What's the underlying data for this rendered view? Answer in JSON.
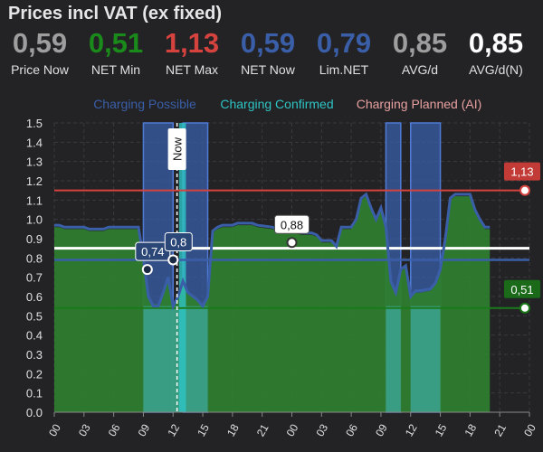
{
  "card": {
    "title": "Prices incl VAT (ex fixed)"
  },
  "stats": [
    {
      "value": "0,59",
      "label": "Price Now",
      "color": "#9e9e9e"
    },
    {
      "value": "0,51",
      "label": "NET Min",
      "color": "#1a8a1a"
    },
    {
      "value": "1,13",
      "label": "NET Max",
      "color": "#d6433f"
    },
    {
      "value": "0,59",
      "label": "NET Now",
      "color": "#3a5fa8"
    },
    {
      "value": "0,79",
      "label": "Lim.NET",
      "color": "#3a5fa8"
    },
    {
      "value": "0,85",
      "label": "AVG/d",
      "color": "#9e9e9e"
    },
    {
      "value": "0,85",
      "label": "AVG/d(N)",
      "color": "#ffffff"
    }
  ],
  "chart_data": {
    "type": "area",
    "title": "",
    "xlabel": "",
    "ylabel": "",
    "x_ticks": [
      "00",
      "03",
      "06",
      "09",
      "12",
      "15",
      "18",
      "21",
      "00",
      "03",
      "06",
      "09",
      "12",
      "15",
      "18",
      "21",
      "00"
    ],
    "y_ticks": [
      "0.0",
      "0.1",
      "0.2",
      "0.3",
      "0.4",
      "0.5",
      "0.6",
      "0.7",
      "0.8",
      "0.9",
      "1.0",
      "1.1",
      "1.2",
      "1.3",
      "1.4",
      "1.5"
    ],
    "ylim": [
      0,
      1.5
    ],
    "xlim": [
      0,
      48
    ],
    "grid": true,
    "legend": [
      "Charging Possible",
      "Charging Confirmed",
      "Charging Planned (AI)"
    ],
    "legend_position": "top",
    "colors": {
      "net_price": "#2e7d2e",
      "price_line": "#3a5fa8",
      "charging_possible": "#3a5fa8",
      "charging_confirmed": "#2ec4c4",
      "charging_planned": "#e8a0a0",
      "max_line": "#d6433f",
      "min_line": "#1a7a1a",
      "avg_line": "#ffffff",
      "lim_line": "#3a5fa8"
    },
    "net_price": [
      [
        0,
        0.96
      ],
      [
        0.5,
        0.96
      ],
      [
        1,
        0.95
      ],
      [
        3,
        0.95
      ],
      [
        3.5,
        0.94
      ],
      [
        5,
        0.94
      ],
      [
        5.5,
        0.95
      ],
      [
        7,
        0.95
      ],
      [
        7.5,
        0.95
      ],
      [
        8.5,
        0.95
      ],
      [
        9,
        0.8
      ],
      [
        9.5,
        0.6
      ],
      [
        10,
        0.56
      ],
      [
        10.5,
        0.56
      ],
      [
        11,
        0.62
      ],
      [
        11.5,
        0.7
      ],
      [
        12,
        0.55
      ],
      [
        12.5,
        0.6
      ],
      [
        13,
        0.68
      ],
      [
        13.5,
        0.62
      ],
      [
        14,
        0.6
      ],
      [
        14.5,
        0.58
      ],
      [
        15,
        0.56
      ],
      [
        15.5,
        0.6
      ],
      [
        16,
        0.93
      ],
      [
        16.5,
        0.95
      ],
      [
        17,
        0.96
      ],
      [
        18,
        0.96
      ],
      [
        18.5,
        0.97
      ],
      [
        20,
        0.97
      ],
      [
        20.5,
        0.96
      ],
      [
        22,
        0.95
      ],
      [
        22.5,
        0.94
      ],
      [
        24,
        0.93
      ],
      [
        25,
        0.92
      ],
      [
        26,
        0.92
      ],
      [
        26.5,
        0.91
      ],
      [
        27,
        0.88
      ],
      [
        28,
        0.88
      ],
      [
        28.5,
        0.85
      ],
      [
        29,
        0.95
      ],
      [
        30,
        0.95
      ],
      [
        30.5,
        1.0
      ],
      [
        31,
        1.1
      ],
      [
        31.5,
        1.12
      ],
      [
        32,
        1.05
      ],
      [
        32.5,
        1.0
      ],
      [
        33,
        1.05
      ],
      [
        33.5,
        0.95
      ],
      [
        34,
        0.68
      ],
      [
        34.5,
        0.62
      ],
      [
        35,
        0.73
      ],
      [
        35.5,
        0.75
      ],
      [
        36,
        0.6
      ],
      [
        36.5,
        0.62
      ],
      [
        37,
        0.62
      ],
      [
        38,
        0.63
      ],
      [
        38.5,
        0.66
      ],
      [
        39,
        0.73
      ],
      [
        39.5,
        0.9
      ],
      [
        40,
        1.1
      ],
      [
        40.5,
        1.12
      ],
      [
        41,
        1.12
      ],
      [
        42,
        1.12
      ],
      [
        42.5,
        1.04
      ],
      [
        43,
        1.0
      ],
      [
        43.5,
        0.95
      ],
      [
        44,
        0.95
      ]
    ],
    "price_line": [
      [
        0,
        0.97
      ],
      [
        0.5,
        0.97
      ],
      [
        1,
        0.96
      ],
      [
        3,
        0.96
      ],
      [
        3.5,
        0.95
      ],
      [
        5,
        0.95
      ],
      [
        5.5,
        0.96
      ],
      [
        7,
        0.96
      ],
      [
        7.5,
        0.96
      ],
      [
        8.5,
        0.96
      ],
      [
        9,
        0.8
      ],
      [
        9.5,
        0.6
      ],
      [
        10,
        0.55
      ],
      [
        10.5,
        0.55
      ],
      [
        11,
        0.62
      ],
      [
        11.5,
        0.7
      ],
      [
        12,
        0.55
      ],
      [
        12.5,
        0.6
      ],
      [
        13,
        0.68
      ],
      [
        13.5,
        0.62
      ],
      [
        14,
        0.6
      ],
      [
        14.5,
        0.58
      ],
      [
        15,
        0.55
      ],
      [
        15.5,
        0.6
      ],
      [
        16,
        0.94
      ],
      [
        16.5,
        0.96
      ],
      [
        17,
        0.97
      ],
      [
        18,
        0.97
      ],
      [
        18.5,
        0.98
      ],
      [
        20,
        0.98
      ],
      [
        20.5,
        0.97
      ],
      [
        22,
        0.96
      ],
      [
        22.5,
        0.95
      ],
      [
        24,
        0.94
      ],
      [
        25,
        0.93
      ],
      [
        26,
        0.93
      ],
      [
        26.5,
        0.92
      ],
      [
        27,
        0.89
      ],
      [
        28,
        0.89
      ],
      [
        28.5,
        0.86
      ],
      [
        29,
        0.96
      ],
      [
        30,
        0.96
      ],
      [
        30.5,
        1.0
      ],
      [
        31,
        1.11
      ],
      [
        31.5,
        1.13
      ],
      [
        32,
        1.06
      ],
      [
        32.5,
        1.0
      ],
      [
        33,
        1.06
      ],
      [
        33.5,
        0.96
      ],
      [
        34,
        0.68
      ],
      [
        34.5,
        0.62
      ],
      [
        35,
        0.74
      ],
      [
        35.5,
        0.76
      ],
      [
        36,
        0.6
      ],
      [
        36.5,
        0.63
      ],
      [
        37,
        0.63
      ],
      [
        38,
        0.64
      ],
      [
        38.5,
        0.67
      ],
      [
        39,
        0.74
      ],
      [
        39.5,
        0.9
      ],
      [
        40,
        1.11
      ],
      [
        40.5,
        1.13
      ],
      [
        41,
        1.13
      ],
      [
        42,
        1.13
      ],
      [
        42.5,
        1.05
      ],
      [
        43,
        1.0
      ],
      [
        43.5,
        0.96
      ],
      [
        44,
        0.96
      ]
    ],
    "charging_possible": [
      [
        9,
        12
      ],
      [
        13,
        15.5
      ],
      [
        33.5,
        35
      ],
      [
        36,
        39
      ]
    ],
    "charging_confirmed": [
      [
        12.6,
        13.3
      ]
    ],
    "charging_confirmed_full": [
      [
        9,
        15.5
      ],
      [
        33.5,
        35
      ],
      [
        36,
        39
      ]
    ],
    "reference_lines": [
      {
        "name": "max",
        "y": 1.15,
        "label": "1,13"
      },
      {
        "name": "min",
        "y": 0.54,
        "label": "0,51"
      },
      {
        "name": "avg",
        "y": 0.85
      },
      {
        "name": "lim",
        "y": 0.79
      }
    ],
    "points": [
      {
        "x": 9.4,
        "y": 0.74,
        "label": "0,74"
      },
      {
        "x": 12,
        "y": 0.79,
        "label": "0,8"
      },
      {
        "x": 24,
        "y": 0.88,
        "label": "0,88"
      }
    ],
    "now_x": 12.4,
    "now_label": "Now"
  }
}
